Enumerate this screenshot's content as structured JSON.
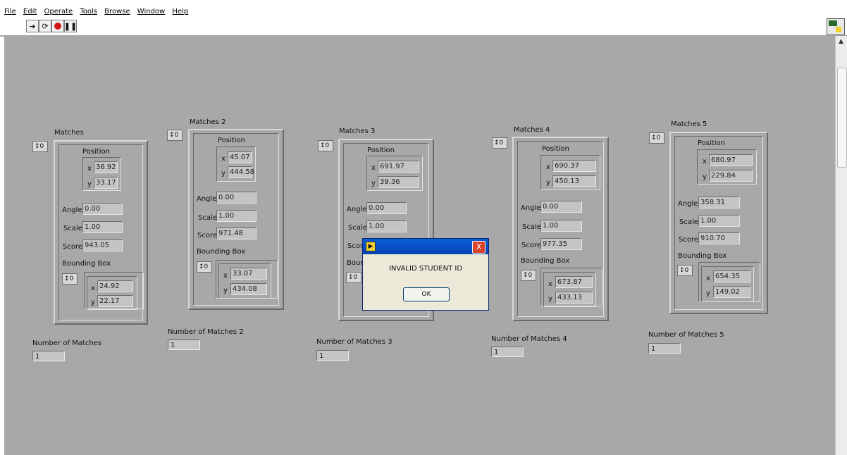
{
  "menu": [
    "File",
    "Edit",
    "Operate",
    "Tools",
    "Browse",
    "Window",
    "Help"
  ],
  "toolbar": {
    "run_icon": "run-arrow-icon",
    "continuous_icon": "run-continuously-icon",
    "abort_icon": "abort-icon",
    "pause_icon": "pause-icon"
  },
  "clusters": [
    {
      "title": "Matches",
      "index": "0",
      "position_label": "Position",
      "x_label": "x",
      "x": "36.92",
      "y_label": "y",
      "y": "33.17",
      "angle_label": "Angle",
      "angle": "0.00",
      "scale_label": "Scale",
      "scale": "1.00",
      "score_label": "Score",
      "score": "943.05",
      "bbox_label": "Bounding Box",
      "bbox_index": "0",
      "bbox_x": "24.92",
      "bbox_y": "22.17",
      "count_label": "Number of Matches",
      "count": "1"
    },
    {
      "title": "Matches 2",
      "index": "0",
      "position_label": "Position",
      "x_label": "x",
      "x": "45.07",
      "y_label": "y",
      "y": "444.58",
      "angle_label": "Angle",
      "angle": "0.00",
      "scale_label": "Scale",
      "scale": "1.00",
      "score_label": "Score",
      "score": "971.48",
      "bbox_label": "Bounding Box",
      "bbox_index": "0",
      "bbox_x": "33.07",
      "bbox_y": "434.08",
      "count_label": "Number of Matches 2",
      "count": "1"
    },
    {
      "title": "Matches 3",
      "index": "0",
      "position_label": "Position",
      "x_label": "x",
      "x": "691.97",
      "y_label": "y",
      "y": "39.36",
      "angle_label": "Angle",
      "angle": "0.00",
      "scale_label": "Scale",
      "scale": "1.00",
      "score_label": "Scor",
      "score": "",
      "bbox_label": "Boun",
      "bbox_index": "0",
      "bbox_x": "",
      "bbox_y": "",
      "count_label": "Number of Matches 3",
      "count": "1"
    },
    {
      "title": "Matches 4",
      "index": "0",
      "position_label": "Position",
      "x_label": "x",
      "x": "690.37",
      "y_label": "y",
      "y": "450.13",
      "angle_label": "Angle",
      "angle": "0.00",
      "scale_label": "Scale",
      "scale": "1.00",
      "score_label": "Score",
      "score": "977.35",
      "bbox_label": "Bounding Box",
      "bbox_index": "0",
      "bbox_x": "673.87",
      "bbox_y": "433.13",
      "count_label": "Number of Matches 4",
      "count": "1"
    },
    {
      "title": "Matches 5",
      "index": "0",
      "position_label": "Position",
      "x_label": "x",
      "x": "680.97",
      "y_label": "y",
      "y": "229.84",
      "angle_label": "Angle",
      "angle": "358.31",
      "scale_label": "Scale",
      "scale": "1.00",
      "score_label": "Score",
      "score": "910.70",
      "bbox_label": "Bounding Box",
      "bbox_index": "0",
      "bbox_x": "654.35",
      "bbox_y": "149.02",
      "count_label": "Number of Matches 5",
      "count": "1"
    }
  ],
  "dialog": {
    "message": "INVALID STUDENT ID",
    "ok_label": "OK",
    "close_label": "X",
    "title_icon": "labview-icon"
  }
}
